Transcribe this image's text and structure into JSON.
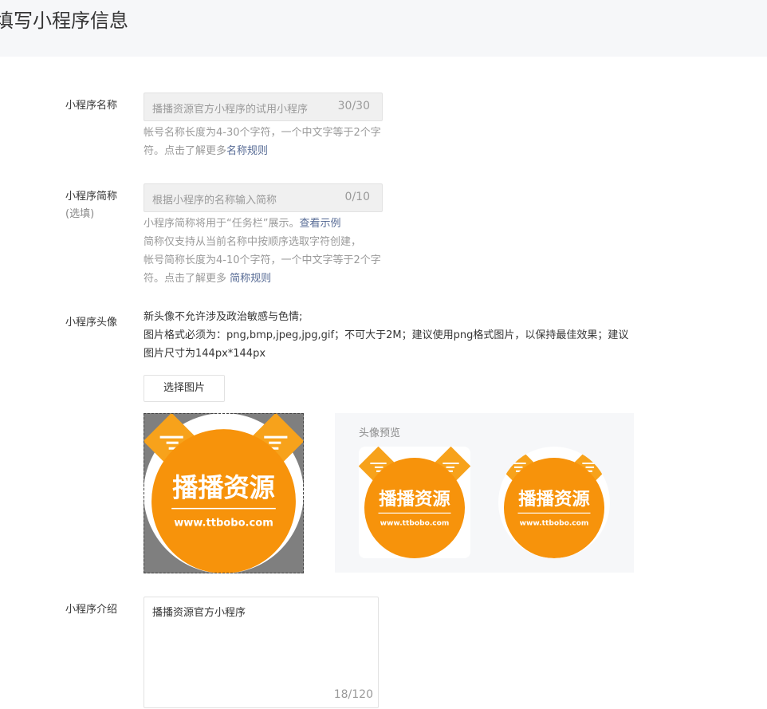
{
  "page": {
    "title": "填写小程序信息"
  },
  "name_field": {
    "label": "小程序名称",
    "placeholder": "播播资源官方小程序的试用小程序",
    "count": "30/30",
    "tip": "帐号名称长度为4-30个字符，一个中文字等于2个字符。点击了解更多",
    "tip_link": "名称规则"
  },
  "short_name_field": {
    "label": "小程序简称",
    "label_sub": "(选填)",
    "placeholder": "根据小程序的名称输入简称",
    "count": "0/10",
    "tip_line1": "小程序简称将用于“任务栏”展示。",
    "tip_line1_link": "查看示例",
    "tip_line2": "简称仅支持从当前名称中按顺序选取字符创建，",
    "tip_line3": "帐号简称长度为4-10个字符，一个中文字等于2个字符。点击了解更多 ",
    "tip_line3_link": "简称规则"
  },
  "avatar_field": {
    "label": "小程序头像",
    "desc_line1": "新头像不允许涉及政治敏感与色情;",
    "desc_line2": "图片格式必须为：png,bmp,jpeg,jpg,gif；不可大于2M；建议使用png格式图片，以保持最佳效果；建议图片尺寸为144px*144px",
    "select_button": "选择图片",
    "preview_title": "头像预览",
    "logo_text": "播播资源",
    "logo_url": "www.ttbobo.com"
  },
  "intro_field": {
    "label": "小程序介绍",
    "value": "播播资源官方小程序",
    "count": "18/120"
  },
  "colors": {
    "logo_orange": "#f7930b",
    "logo_ear": "#f7a21b",
    "link": "#576b95"
  }
}
